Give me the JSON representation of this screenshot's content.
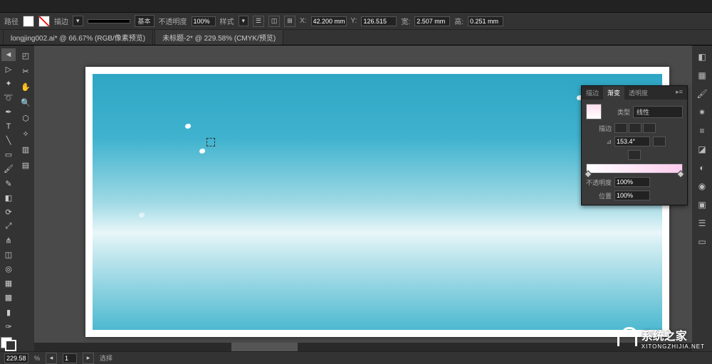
{
  "control_bar": {
    "path_label": "路径",
    "stroke_label": "描边",
    "stroke_weight": "",
    "profile_label": "基本",
    "opacity_label": "不透明度",
    "opacity_value": "100%",
    "style_label": "样式",
    "x_label": "X:",
    "x_value": "42.200 mm",
    "y_label": "Y:",
    "y_value": "126.515",
    "w_label": "宽:",
    "w_value": "2.507 mm",
    "h_label": "高:",
    "h_value": "0.251 mm"
  },
  "tabs": [
    {
      "label": "longjing002.ai* @ 66.67% (RGB/像素预览)",
      "active": false
    },
    {
      "label": "未标题-2* @ 229.58% (CMYK/预览)",
      "active": true
    }
  ],
  "gradient_panel": {
    "tabs": [
      "描边",
      "渐变",
      "透明度"
    ],
    "active_tab": "渐变",
    "type_label": "类型",
    "type_value": "线性",
    "stroke_label": "描边",
    "angle_value": "153.4°",
    "opacity_label": "不透明度",
    "opacity_value": "100%",
    "location_label": "位置",
    "location_value": "100%"
  },
  "status": {
    "zoom": "229.58",
    "nav": "1",
    "tool": "选择"
  },
  "watermark": {
    "text": "系统之家",
    "url": "XITONGZHIJIA.NET"
  }
}
